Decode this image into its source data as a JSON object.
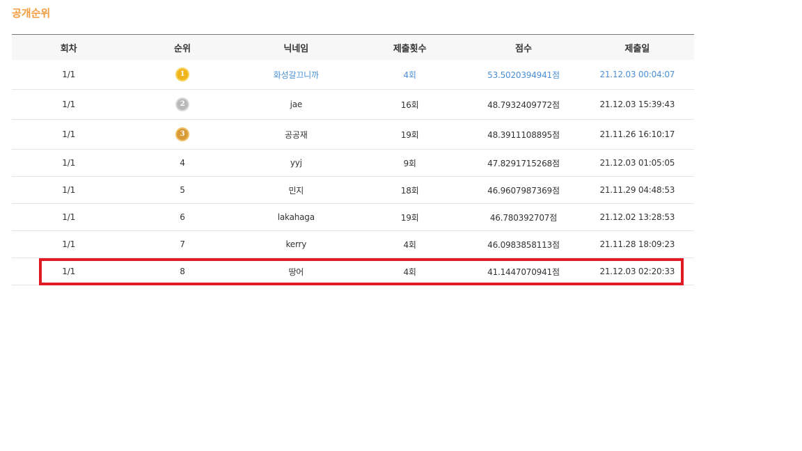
{
  "page": {
    "title": "공개순위"
  },
  "table": {
    "headers": [
      "회차",
      "순위",
      "닉네임",
      "제출횟수",
      "점수",
      "제출일"
    ],
    "rows": [
      {
        "round": "1/1",
        "rank": "1",
        "rank_icon": "gold-medal-icon",
        "nickname": "화성갈끄니까",
        "submissions": "4회",
        "score": "53.5020394941점",
        "date": "21.12.03 00:04:07"
      },
      {
        "round": "1/1",
        "rank": "2",
        "rank_icon": "silver-medal-icon",
        "nickname": "jae",
        "submissions": "16회",
        "score": "48.7932409772점",
        "date": "21.12.03 15:39:43"
      },
      {
        "round": "1/1",
        "rank": "3",
        "rank_icon": "bronze-medal-icon",
        "nickname": "공공재",
        "submissions": "19회",
        "score": "48.3911108895점",
        "date": "21.11.26 16:10:17"
      },
      {
        "round": "1/1",
        "rank": "4",
        "nickname": "yyj",
        "submissions": "9회",
        "score": "47.8291715268점",
        "date": "21.12.03 01:05:05"
      },
      {
        "round": "1/1",
        "rank": "5",
        "nickname": "민지",
        "submissions": "18회",
        "score": "46.9607987369점",
        "date": "21.11.29 04:48:53"
      },
      {
        "round": "1/1",
        "rank": "6",
        "nickname": "lakahaga",
        "submissions": "19회",
        "score": "46.780392707점",
        "date": "21.12.02 13:28:53"
      },
      {
        "round": "1/1",
        "rank": "7",
        "nickname": "kerry",
        "submissions": "4회",
        "score": "46.0983858113점",
        "date": "21.11.28 18:09:23"
      },
      {
        "round": "1/1",
        "rank": "8",
        "nickname": "땅어",
        "submissions": "4회",
        "score": "41.1447070941점",
        "date": "21.12.03 02:20:33"
      }
    ]
  },
  "colors": {
    "title_accent": "#f39c3d",
    "first_place_text": "#4a8fd6",
    "highlight_border": "#e01b24",
    "gold": "#f1b51c",
    "silver": "#b9b9b9",
    "bronze": "#d79a34"
  }
}
